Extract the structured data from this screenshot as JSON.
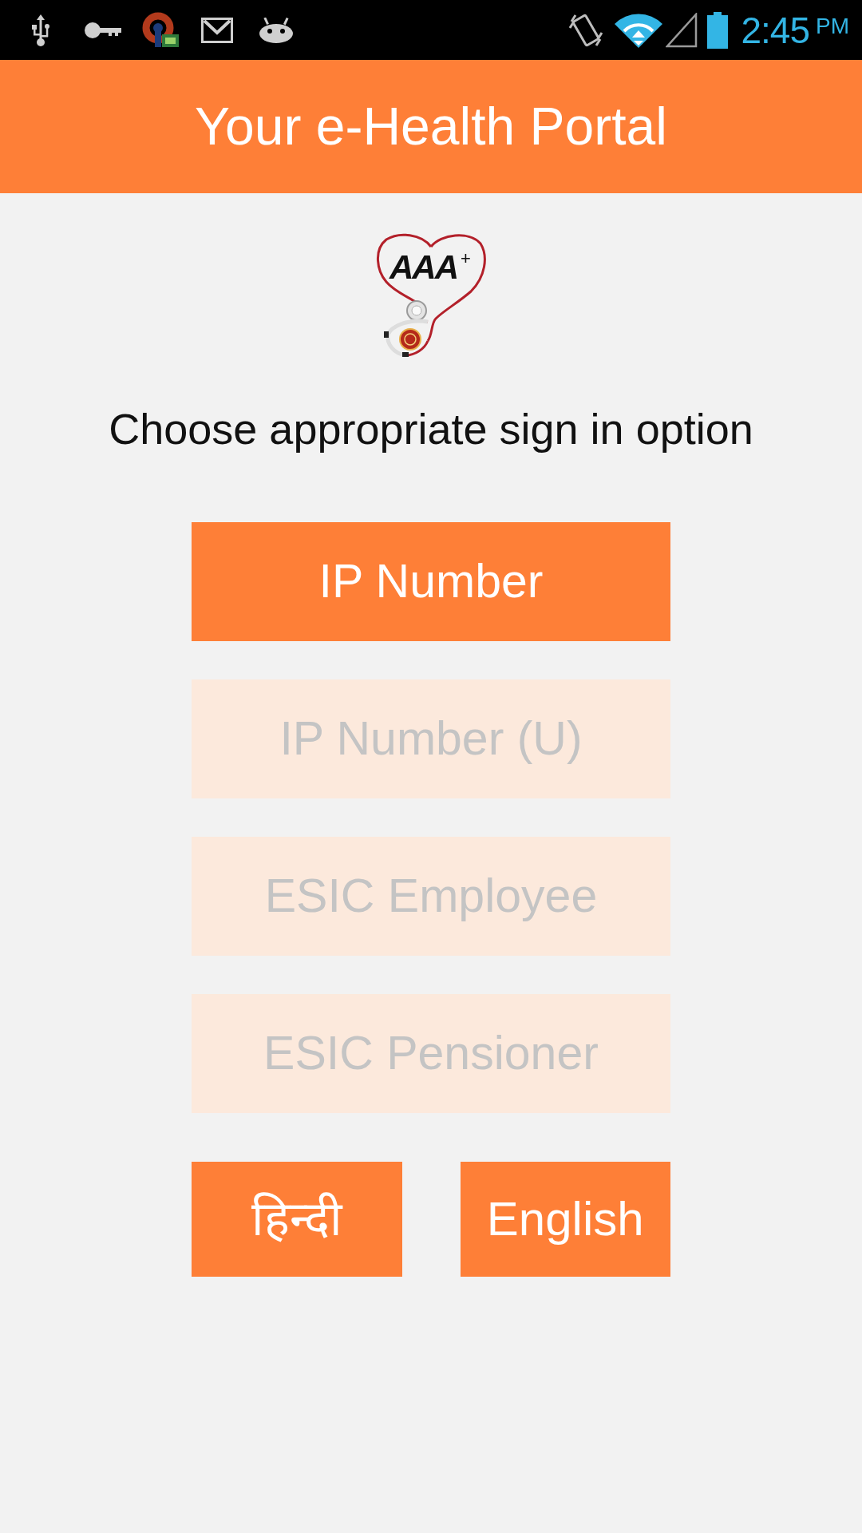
{
  "status_bar": {
    "time": "2:45",
    "meridiem": "PM"
  },
  "app_bar": {
    "title": "Your e-Health Portal"
  },
  "logo": {
    "text": "AAA$^{+}$"
  },
  "prompt": "Choose appropriate sign in option",
  "sign_in_options": [
    {
      "label": "IP Number",
      "disabled": false
    },
    {
      "label": "IP Number (U)",
      "disabled": true
    },
    {
      "label": "ESIC Employee",
      "disabled": true
    },
    {
      "label": "ESIC Pensioner",
      "disabled": true
    }
  ],
  "language_buttons": [
    {
      "label": "हिन्दी"
    },
    {
      "label": "English"
    }
  ]
}
